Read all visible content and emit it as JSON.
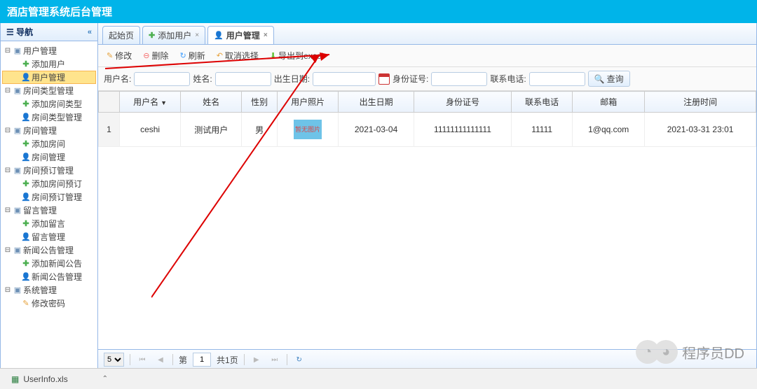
{
  "app_title": "酒店管理系统后台管理",
  "sidebar": {
    "title": "导航",
    "tree": [
      {
        "label": "用户管理",
        "type": "folder",
        "children": [
          {
            "label": "添加用户",
            "type": "add"
          },
          {
            "label": "用户管理",
            "type": "user",
            "selected": true
          }
        ]
      },
      {
        "label": "房间类型管理",
        "type": "folder",
        "children": [
          {
            "label": "添加房间类型",
            "type": "add"
          },
          {
            "label": "房间类型管理",
            "type": "user"
          }
        ]
      },
      {
        "label": "房间管理",
        "type": "folder",
        "children": [
          {
            "label": "添加房间",
            "type": "add"
          },
          {
            "label": "房间管理",
            "type": "user"
          }
        ]
      },
      {
        "label": "房间预订管理",
        "type": "folder",
        "children": [
          {
            "label": "添加房间预订",
            "type": "add"
          },
          {
            "label": "房间预订管理",
            "type": "user"
          }
        ]
      },
      {
        "label": "留言管理",
        "type": "folder",
        "children": [
          {
            "label": "添加留言",
            "type": "add"
          },
          {
            "label": "留言管理",
            "type": "user"
          }
        ]
      },
      {
        "label": "新闻公告管理",
        "type": "folder",
        "children": [
          {
            "label": "添加新闻公告",
            "type": "add"
          },
          {
            "label": "新闻公告管理",
            "type": "user"
          }
        ]
      },
      {
        "label": "系统管理",
        "type": "folder",
        "children": [
          {
            "label": "修改密码",
            "type": "pencil"
          }
        ]
      }
    ]
  },
  "tabs": [
    {
      "label": "起始页",
      "icon": "none",
      "closable": false
    },
    {
      "label": "添加用户",
      "icon": "add",
      "closable": true
    },
    {
      "label": "用户管理",
      "icon": "user",
      "closable": true,
      "active": true
    }
  ],
  "toolbar": {
    "edit_label": "修改",
    "delete_label": "删除",
    "refresh_label": "刷新",
    "cancel_label": "取消选择",
    "excel_label": "导出到excel"
  },
  "search": {
    "username_label": "用户名:",
    "name_label": "姓名:",
    "birth_label": "出生日期:",
    "idcard_label": "身份证号:",
    "phone_label": "联系电话:",
    "query_label": "查询"
  },
  "grid": {
    "columns": [
      "用户名",
      "姓名",
      "性别",
      "用户照片",
      "出生日期",
      "身份证号",
      "联系电话",
      "邮箱",
      "注册时间"
    ],
    "rows": [
      {
        "num": "1",
        "username": "ceshi",
        "name": "测试用户",
        "sex": "男",
        "photo": "暂无图片",
        "birth": "2021-03-04",
        "idcard": "11111111111111",
        "phone": "11111",
        "email": "1@qq.com",
        "regtime": "2021-03-31 23:01"
      }
    ]
  },
  "pager": {
    "page_size": "5",
    "page_label": "第",
    "page_value": "1",
    "total_label": "共1页"
  },
  "download": {
    "filename": "UserInfo.xls"
  },
  "watermark": "程序员DD"
}
